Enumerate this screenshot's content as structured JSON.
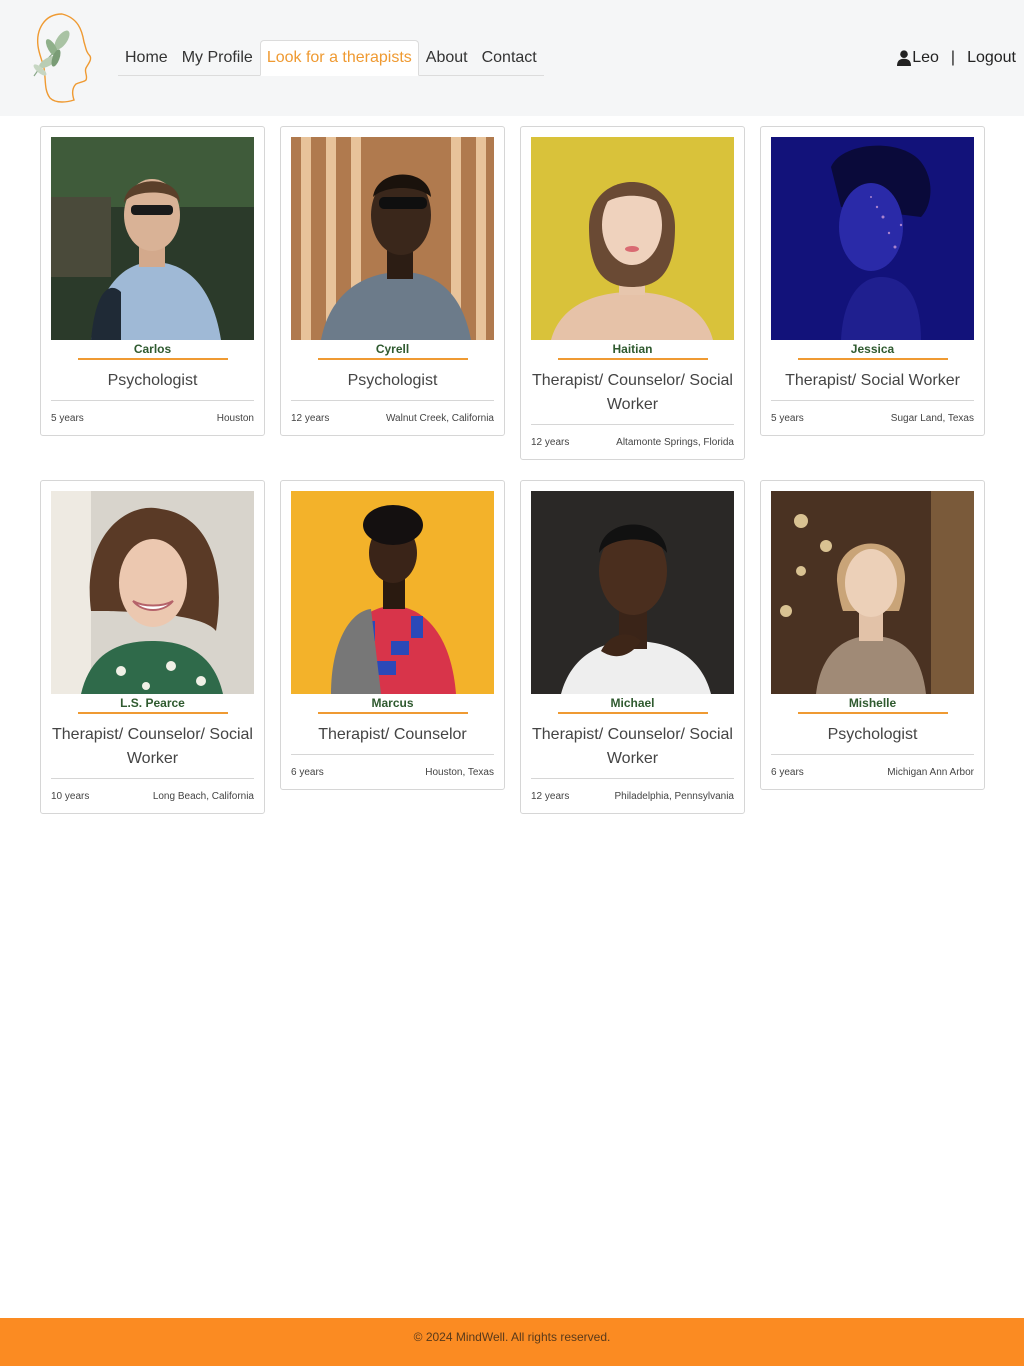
{
  "nav": {
    "items": [
      "Home",
      "My Profile",
      "Look for a therapists",
      "About",
      "Contact"
    ],
    "active_index": 2
  },
  "user": {
    "name": "Leo",
    "separator": "|",
    "logout_label": "Logout"
  },
  "therapists": [
    {
      "name": "Carlos",
      "role": "Psychologist",
      "experience": "5 years",
      "location": "Houston"
    },
    {
      "name": "Cyrell",
      "role": "Psychologist",
      "experience": "12 years",
      "location": "Walnut Creek, California"
    },
    {
      "name": "Haitian",
      "role": "Therapist/ Counselor/ Social Worker",
      "experience": "12 years",
      "location": "Altamonte Springs, Florida"
    },
    {
      "name": "Jessica",
      "role": "Therapist/ Social Worker",
      "experience": "5 years",
      "location": "Sugar Land, Texas"
    },
    {
      "name": "L.S. Pearce",
      "role": "Therapist/ Counselor/ Social Worker",
      "experience": "10 years",
      "location": "Long Beach, California"
    },
    {
      "name": "Marcus",
      "role": "Therapist/ Counselor",
      "experience": "6 years",
      "location": "Houston, Texas"
    },
    {
      "name": "Michael",
      "role": "Therapist/ Counselor/ Social Worker",
      "experience": "12 years",
      "location": "Philadelphia, Pennsylvania"
    },
    {
      "name": "Mishelle",
      "role": "Psychologist",
      "experience": "6 years",
      "location": "Michigan Ann Arbor"
    }
  ],
  "footer": {
    "copyright": "© 2024 MindWell. All rights reserved."
  },
  "colors": {
    "accent": "#ef9a32",
    "footer_bg": "#fb8b22",
    "name_green": "#2f5a2f"
  },
  "icons": {
    "logo": "leaf-face-logo",
    "user": "user-icon"
  }
}
